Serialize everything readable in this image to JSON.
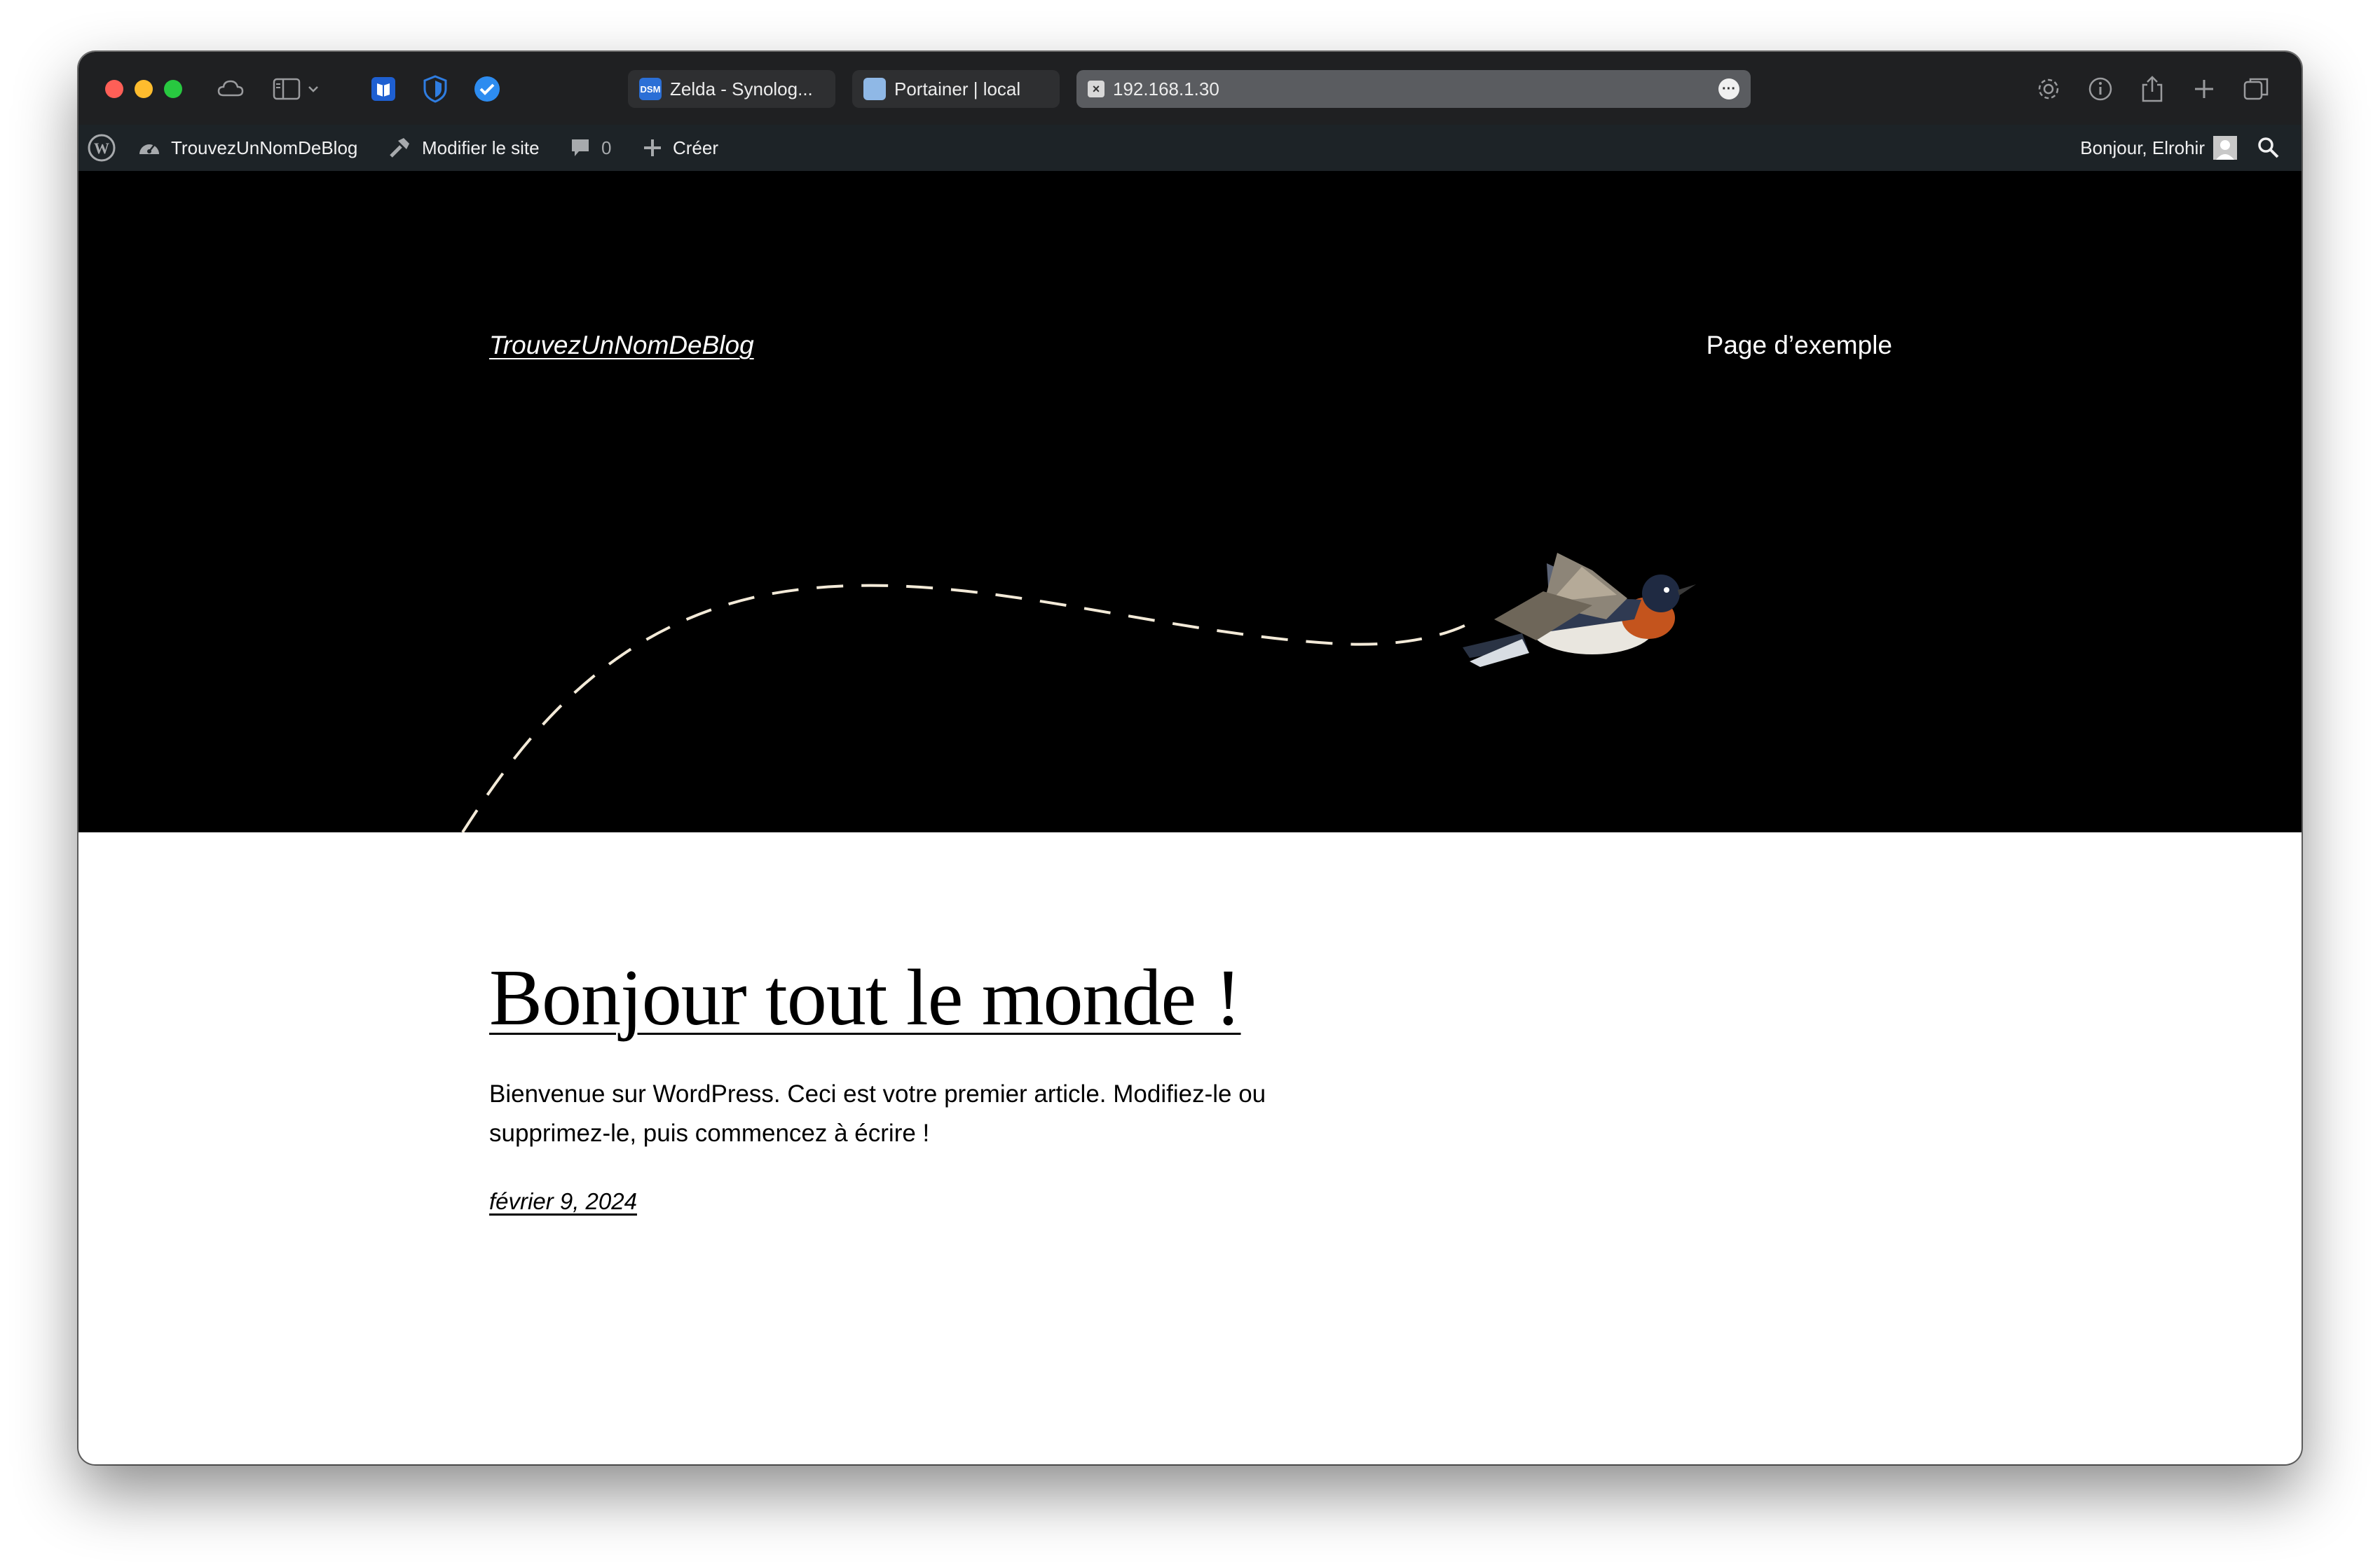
{
  "browser": {
    "tabs": [
      {
        "label": "Zelda - Synolog...",
        "favicon_text": "DSM",
        "favicon_color": "#2b6fd6"
      },
      {
        "label": "Portainer | local",
        "favicon_color": "#8fb8e6"
      },
      {
        "label": "192.168.1.30",
        "active": true
      }
    ]
  },
  "adminbar": {
    "site_name": "TrouvezUnNomDeBlog",
    "edit_site": "Modifier le site",
    "comments_count": "0",
    "new_label": "Créer",
    "greeting": "Bonjour, Elrohir"
  },
  "header": {
    "site_title": "TrouvezUnNomDeBlog",
    "nav_link": "Page d’exemple"
  },
  "post": {
    "title": "Bonjour tout le monde !",
    "excerpt": "Bienvenue sur WordPress. Ceci est votre premier article. Modifiez-le ou supprimez-le, puis commencez à écrire !",
    "date": "février 9, 2024"
  },
  "colors": {
    "titlebar": "#1f2022",
    "adminbar": "#1d2327",
    "hero_background": "#000000",
    "dash_line": "#f3ead8",
    "bird_breast": "#c4541d"
  }
}
